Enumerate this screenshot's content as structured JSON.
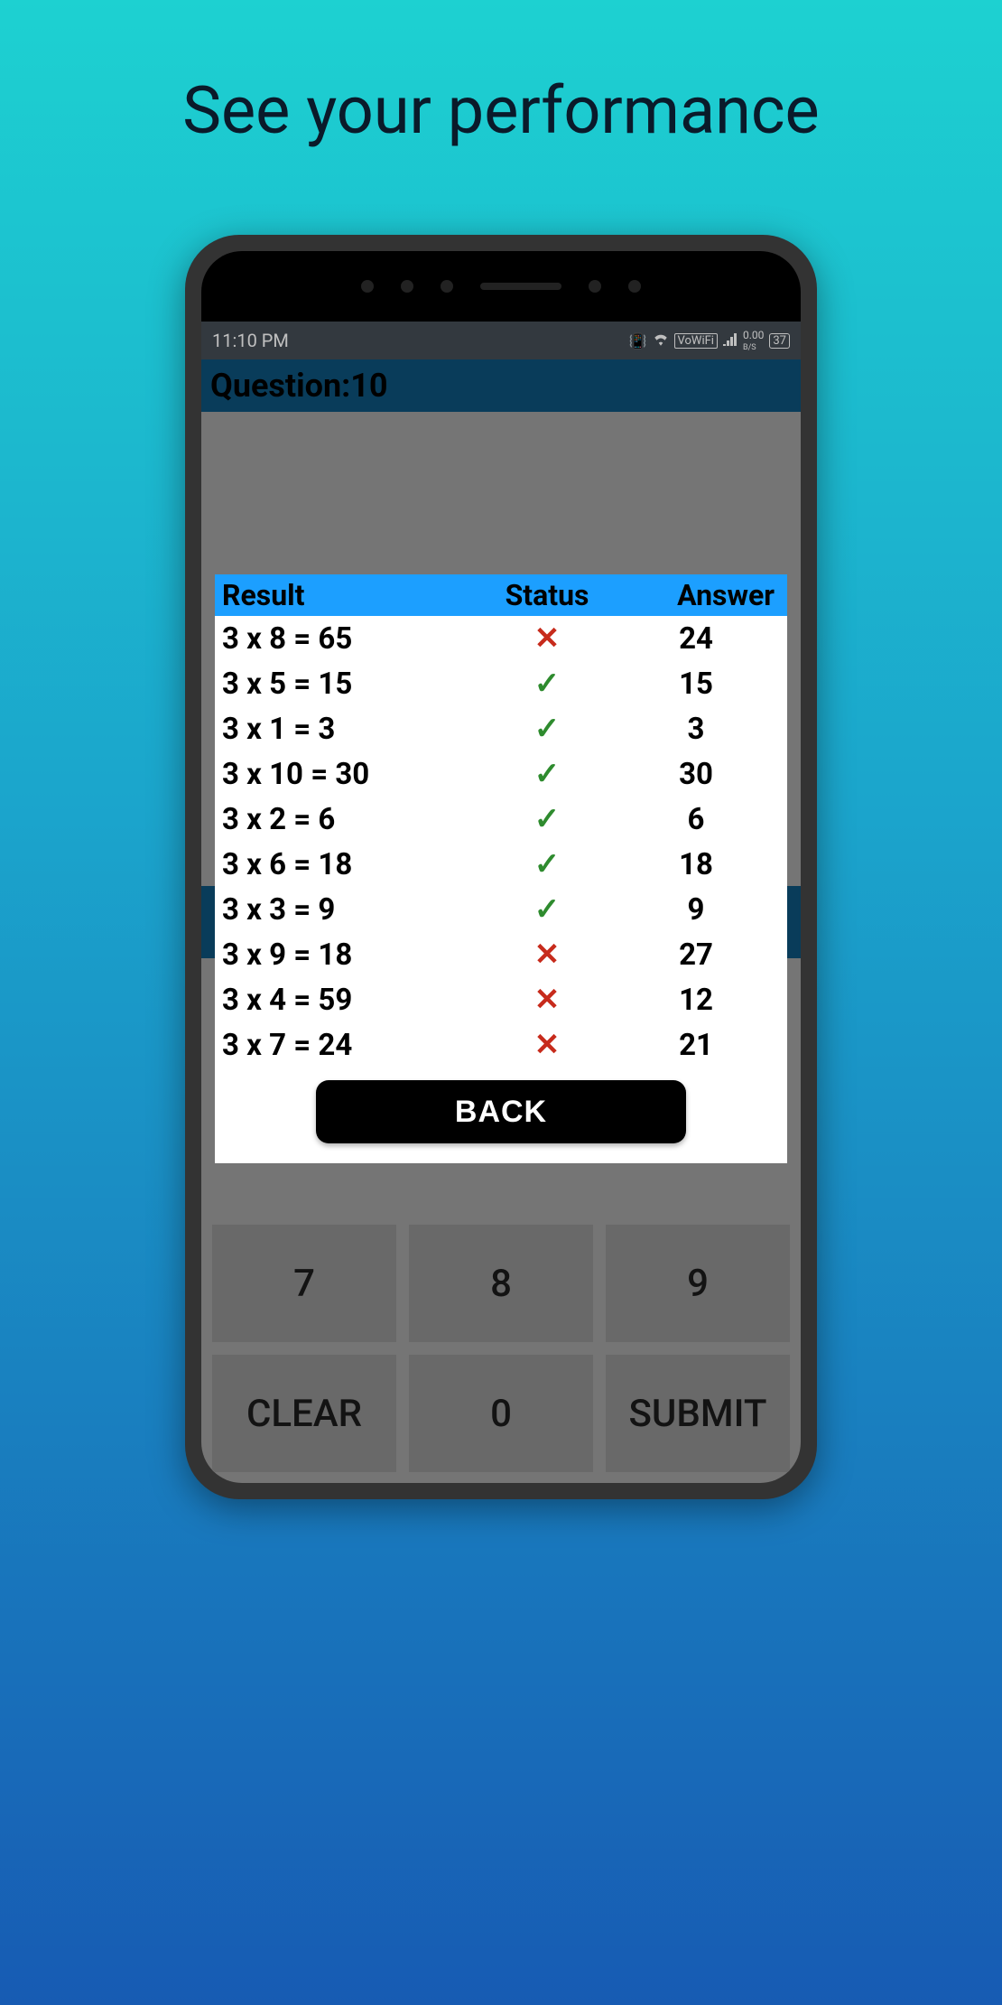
{
  "promo": {
    "title": "See your performance"
  },
  "statusbar": {
    "time": "11:10 PM",
    "vowifi": "VoWiFi",
    "net_speed": "0.00",
    "net_unit": "B/S",
    "battery": "37"
  },
  "question_bar": {
    "label": "Question:10"
  },
  "results": {
    "headers": {
      "result": "Result",
      "status": "Status",
      "answer": "Answer"
    },
    "rows": [
      {
        "expr": "3 x 8 = 65",
        "correct": false,
        "answer": "24"
      },
      {
        "expr": "3 x 5 = 15",
        "correct": true,
        "answer": "15"
      },
      {
        "expr": "3 x 1 = 3",
        "correct": true,
        "answer": "3"
      },
      {
        "expr": "3 x 10 = 30",
        "correct": true,
        "answer": "30"
      },
      {
        "expr": "3 x 2 = 6",
        "correct": true,
        "answer": "6"
      },
      {
        "expr": "3 x 6 = 18",
        "correct": true,
        "answer": "18"
      },
      {
        "expr": "3 x 3 = 9",
        "correct": true,
        "answer": "9"
      },
      {
        "expr": "3 x 9 = 18",
        "correct": false,
        "answer": "27"
      },
      {
        "expr": "3 x 4 = 59",
        "correct": false,
        "answer": "12"
      },
      {
        "expr": "3 x 7 = 24",
        "correct": false,
        "answer": "21"
      }
    ],
    "back_label": "BACK"
  },
  "keypad": {
    "keys": [
      "7",
      "8",
      "9",
      "CLEAR",
      "0",
      "SUBMIT"
    ]
  }
}
